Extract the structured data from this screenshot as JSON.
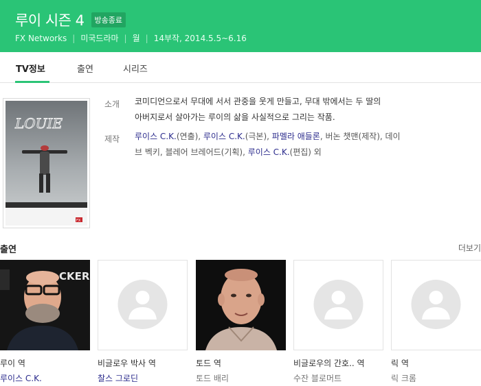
{
  "header": {
    "title": "루이 시즌 4",
    "badge": "방송종료",
    "network": "FX Networks",
    "genre": "미국드라마",
    "day": "월",
    "episodes_dates": "14부작, 2014.5.5~6.16"
  },
  "tabs": [
    {
      "label": "TV정보"
    },
    {
      "label": "출연"
    },
    {
      "label": "시리즈"
    }
  ],
  "poster": {
    "title_text": "LOUIE",
    "network_logo": "FX"
  },
  "info": {
    "intro_label": "소개",
    "intro_line1": "코미디언으로서 무대에 서서 관중을 웃게 만들고, 무대 밖에서는 두 딸의",
    "intro_line2": "아버지로서 살아가는 루이의 삶을 사실적으로 그리는 작품.",
    "production_label": "제작",
    "credits": {
      "c1_name": "루이스 C.K.",
      "c1_role": "(연출), ",
      "c2_name": "루이스 C.K.",
      "c2_role": "(극본), ",
      "c3_name": "파멜라 애들론",
      "c3_rest": ", 버논 챗맨(제작), 데이",
      "line2_start": "브 벡키, 블레어 브레어드(기획), ",
      "c4_name": "루이스 C.K.",
      "c4_role": "(편집) 외"
    }
  },
  "cast_section": {
    "title": "출연",
    "more": "더보기"
  },
  "cast": [
    {
      "role": "루이 역",
      "actor": "루이스 C.K.",
      "photo_text": "CKER"
    },
    {
      "role": "비글로우 박사 역",
      "actor": "찰스 그로딘"
    },
    {
      "role": "토드 역",
      "actor": "토드 배리"
    },
    {
      "role": "비글로우의 간호.. 역",
      "actor": "수잔 블로머트"
    },
    {
      "role": "릭 역",
      "actor": "릭 크롬"
    }
  ],
  "colors": {
    "brand_green": "#2ac476",
    "link_navy": "#2b2b8c"
  }
}
